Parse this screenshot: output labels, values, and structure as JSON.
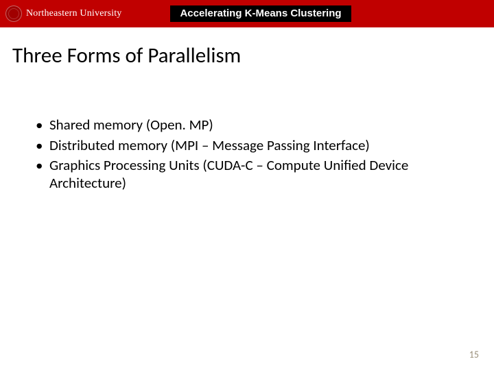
{
  "banner": {
    "university": "Northeastern University",
    "deck_title": "Accelerating K-Means Clustering"
  },
  "slide": {
    "title": "Three Forms of Parallelism",
    "bullets": [
      "Shared memory (Open. MP)",
      "Distributed memory (MPI – Message Passing Interface)",
      "Graphics Processing Units (CUDA-C – Compute Unified Device Architecture)"
    ],
    "page_number": "15"
  }
}
